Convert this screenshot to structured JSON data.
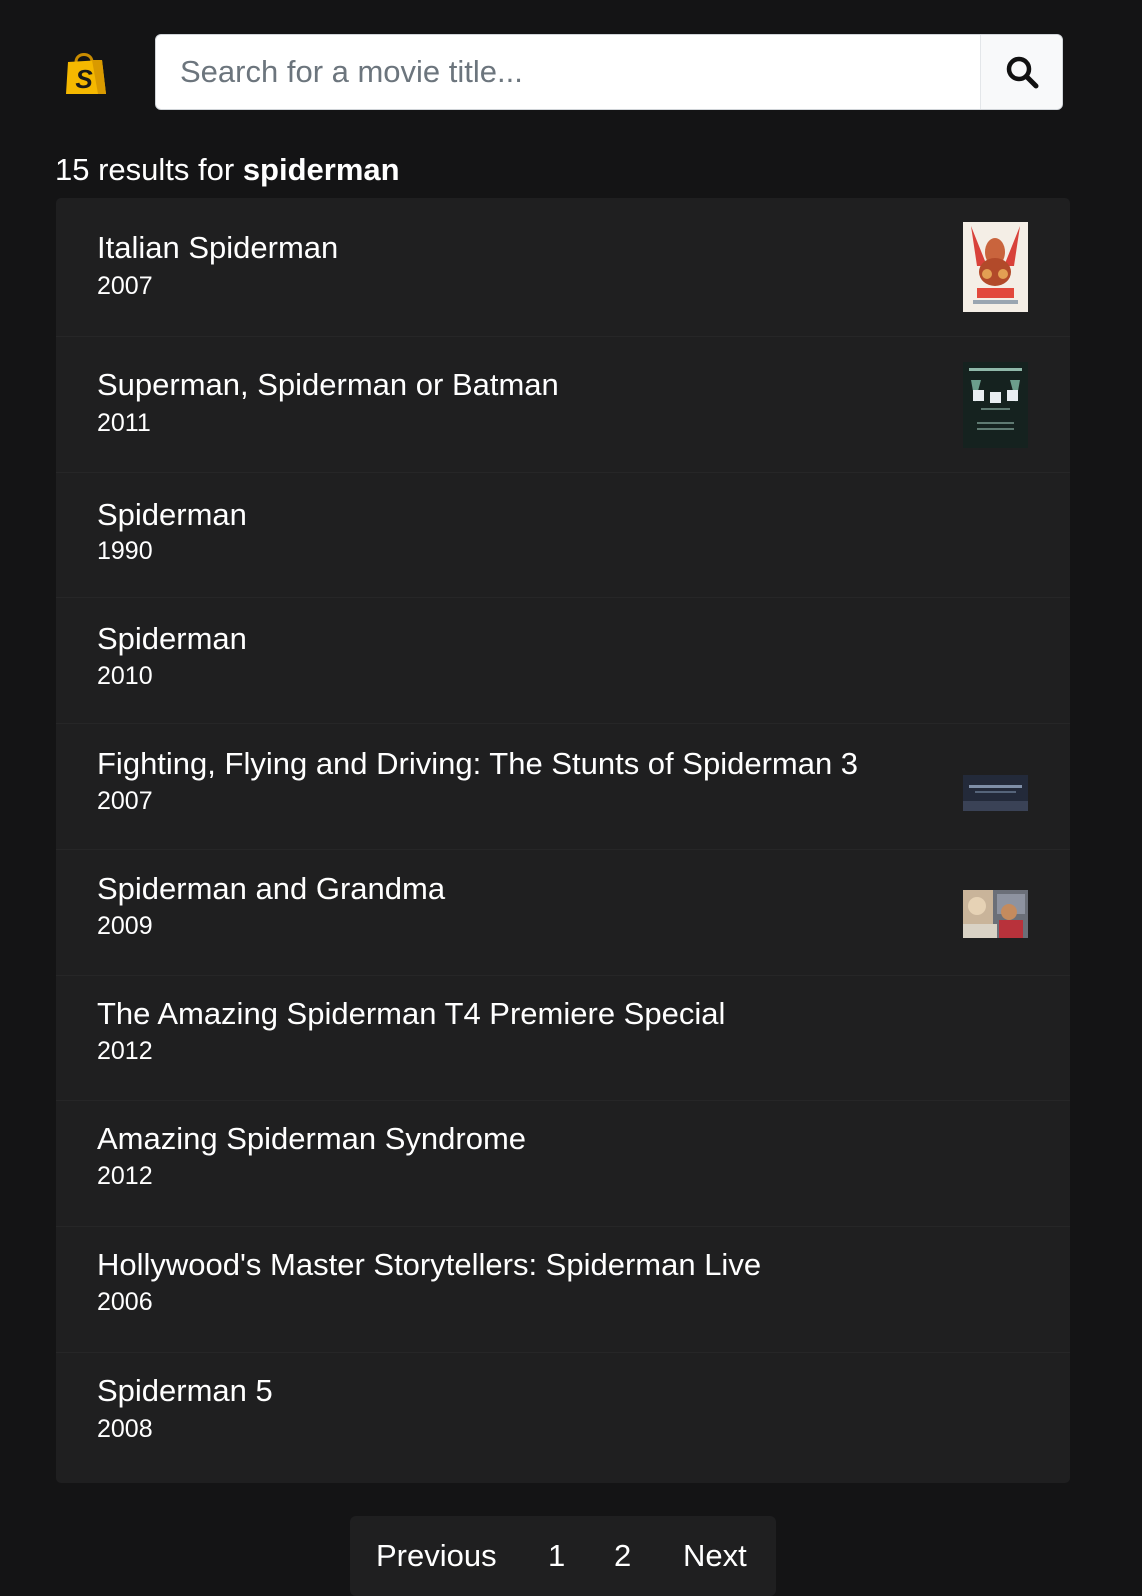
{
  "search": {
    "placeholder": "Search for a movie title...",
    "value": ""
  },
  "results": {
    "count_text": "15 results for ",
    "query": "spiderman"
  },
  "movies": [
    {
      "title": "Italian Spiderman",
      "year": "2007",
      "thumbnail": "poster-italian-spiderman"
    },
    {
      "title": "Superman, Spiderman or Batman",
      "year": "2011",
      "thumbnail": "poster-superman-spiderman-batman"
    },
    {
      "title": "Spiderman",
      "year": "1990",
      "thumbnail": null
    },
    {
      "title": "Spiderman",
      "year": "2010",
      "thumbnail": null
    },
    {
      "title": "Fighting, Flying and Driving: The Stunts of Spiderman 3",
      "year": "2007",
      "thumbnail": "still-stunts-spiderman-3"
    },
    {
      "title": "Spiderman and Grandma",
      "year": "2009",
      "thumbnail": "still-spiderman-grandma"
    },
    {
      "title": "The Amazing Spiderman T4 Premiere Special",
      "year": "2012",
      "thumbnail": null
    },
    {
      "title": "Amazing Spiderman Syndrome",
      "year": "2012",
      "thumbnail": null
    },
    {
      "title": "Hollywood's Master Storytellers: Spiderman Live",
      "year": "2006",
      "thumbnail": null
    },
    {
      "title": "Spiderman 5",
      "year": "2008",
      "thumbnail": null
    }
  ],
  "pagination": {
    "previous": "Previous",
    "pages": [
      "1",
      "2"
    ],
    "next": "Next"
  },
  "colors": {
    "background": "#141415",
    "card": "#1f1f20",
    "logo_bag": "#f5b800"
  },
  "icons": {
    "logo": "shopping-bag-logo-icon",
    "search": "search-icon"
  }
}
